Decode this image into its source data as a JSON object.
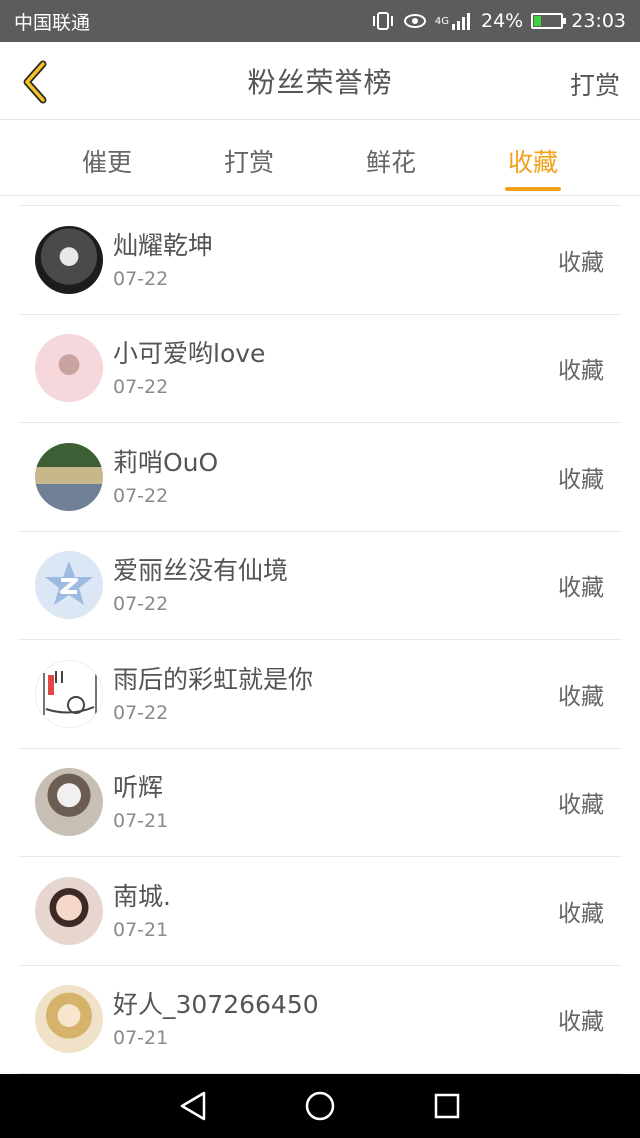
{
  "status_bar": {
    "carrier": "中国联通",
    "network": "4G",
    "battery": "24%",
    "time": "23:03"
  },
  "header": {
    "title": "粉丝荣誉榜",
    "right_action": "打赏"
  },
  "tabs": [
    {
      "label": "催更",
      "active": false
    },
    {
      "label": "打赏",
      "active": false
    },
    {
      "label": "鲜花",
      "active": false
    },
    {
      "label": "收藏",
      "active": true
    }
  ],
  "accent_color": "#f4a11c",
  "list": [
    {
      "name": "灿耀乾坤",
      "date": "07-22",
      "action": "收藏"
    },
    {
      "name": "小可爱哟love",
      "date": "07-22",
      "action": "收藏"
    },
    {
      "name": "莉哨OuO",
      "date": "07-22",
      "action": "收藏"
    },
    {
      "name": "爱丽丝没有仙境",
      "date": "07-22",
      "action": "收藏"
    },
    {
      "name": "雨后的彩虹就是你",
      "date": "07-22",
      "action": "收藏"
    },
    {
      "name": "听辉",
      "date": "07-21",
      "action": "收藏"
    },
    {
      "name": "南城.",
      "date": "07-21",
      "action": "收藏"
    },
    {
      "name": "好人_307266450",
      "date": "07-21",
      "action": "收藏"
    }
  ]
}
